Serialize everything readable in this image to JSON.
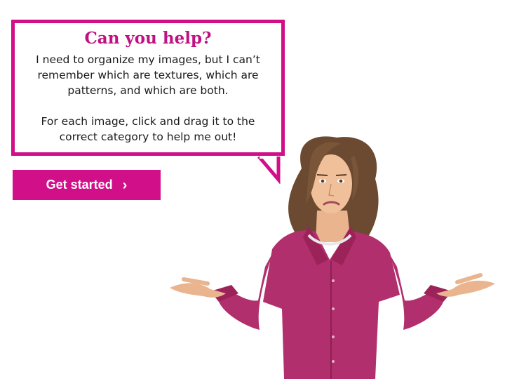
{
  "dialog": {
    "title": "Can you help?",
    "paragraph1": "I need to organize my images, but I can’t remember which are textures, which are patterns, and which are both.",
    "paragraph2": "For each image, click and drag it to the correct category to help me out!"
  },
  "start_button": {
    "label": "Get started",
    "icon": "chevron-right-icon"
  },
  "character": {
    "icon": "woman-shrugging-illustration"
  },
  "colors": {
    "accent": "#d10f89",
    "shirt": "#b12f6c"
  }
}
